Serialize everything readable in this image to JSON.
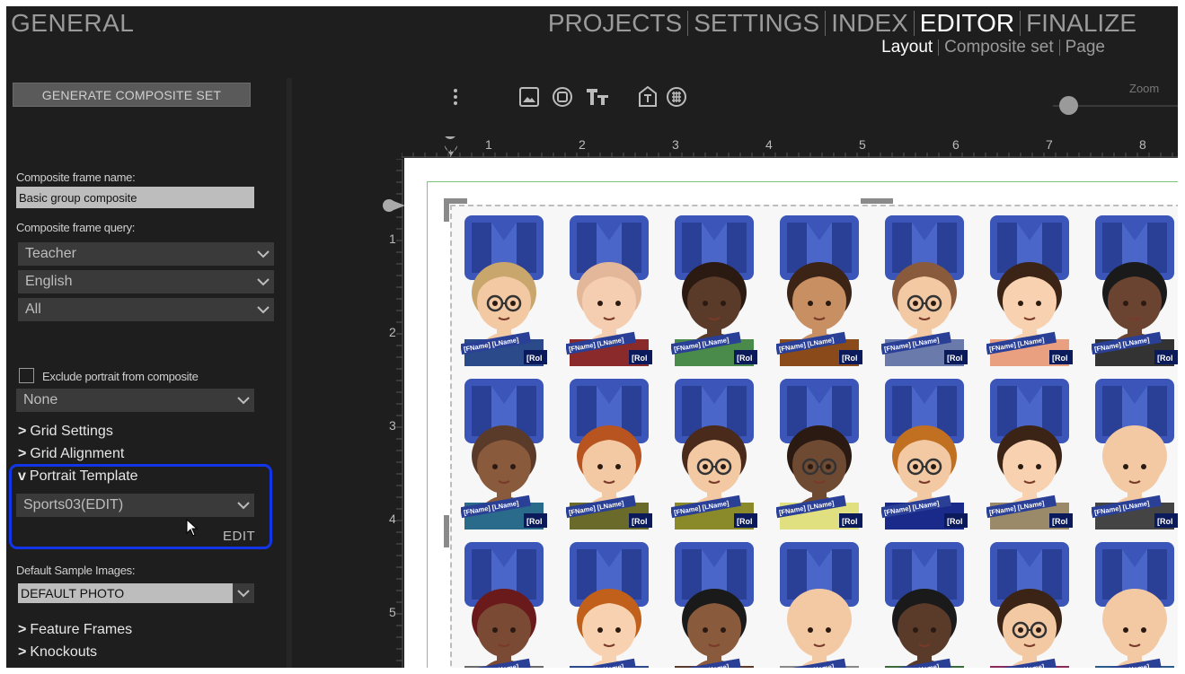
{
  "app": {
    "section_title": "GENERAL"
  },
  "main_nav": [
    {
      "label": "PROJECTS",
      "active": false
    },
    {
      "label": "SETTINGS",
      "active": false
    },
    {
      "label": "INDEX",
      "active": false
    },
    {
      "label": "EDITOR",
      "active": true
    },
    {
      "label": "FINALIZE",
      "active": false
    }
  ],
  "sub_nav": [
    {
      "label": "Layout",
      "active": true
    },
    {
      "label": "Composite set",
      "active": false
    },
    {
      "label": "Page",
      "active": false
    }
  ],
  "left_panel": {
    "generate_button": "GENERATE COMPOSITE SET",
    "frame_name_label": "Composite frame name:",
    "frame_name_value": "Basic group composite",
    "frame_query_label": "Composite frame query:",
    "query_dropdowns": [
      "Teacher",
      "English",
      "All"
    ],
    "exclude_label": "Exclude portrait from composite",
    "exclude_checked": false,
    "exclude_dropdown": "None",
    "sections": {
      "grid_settings": "Grid Settings",
      "grid_alignment": "Grid Alignment",
      "portrait_template": "Portrait Template",
      "feature_frames": "Feature Frames",
      "knockouts": "Knockouts"
    },
    "section_markers": {
      "collapsed": ">",
      "expanded": "v"
    },
    "portrait_template_value": "Sports03(EDIT)",
    "edit_label": "EDIT",
    "sample_images_label": "Default Sample Images:",
    "sample_images_value": "DEFAULT PHOTO"
  },
  "toolbar": {
    "icons": [
      "more-vertical-icon",
      "image-frame-icon",
      "shape-frame-icon",
      "text-frame-icon",
      "template-text-icon",
      "grid-frame-icon"
    ],
    "zoom_label": "Zoom",
    "zoom_level": 0.12
  },
  "rulers": {
    "horizontal": [
      "1",
      "2",
      "3",
      "4",
      "5",
      "6",
      "7",
      "8"
    ],
    "vertical": [
      "1",
      "2",
      "3",
      "4",
      "5"
    ]
  },
  "portrait_labels": {
    "name_tag": "[FName] [LName]",
    "role_tag": "[Rol"
  },
  "colors": {
    "highlight_border": "#1235e8",
    "panel_bg": "#1e1e1e",
    "frame_green": "#7cc67c",
    "logo_blue": "#3b56b8"
  }
}
